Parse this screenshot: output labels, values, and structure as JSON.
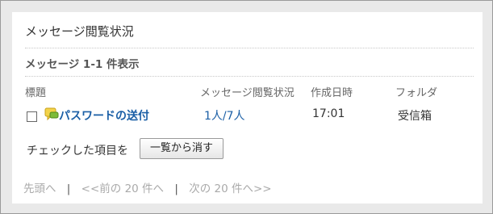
{
  "header": {
    "title": "メッセージ閲覧状況"
  },
  "summary": {
    "count_text": "メッセージ 1-1 件表示"
  },
  "table": {
    "columns": {
      "subject": "標題",
      "status": "メッセージ閲覧状況",
      "date": "作成日時",
      "folder": "フォルダ"
    },
    "rows": [
      {
        "subject": "パスワードの送付",
        "status": "1人/7人",
        "date": "17:01",
        "folder": "受信箱"
      }
    ]
  },
  "bulk": {
    "label": "チェックした項目を",
    "button": "一覧から消す"
  },
  "pager": {
    "first": "先頭へ",
    "prev": "<<前の 20 件へ",
    "next": "次の 20 件へ>>",
    "separator": "|"
  },
  "colors": {
    "link": "#1b5fa6",
    "muted": "#aaaaaa",
    "icon_yellow": "#f3d34a",
    "icon_green": "#7dbb3a"
  },
  "icons": {
    "message": "message-bubble-icon"
  }
}
